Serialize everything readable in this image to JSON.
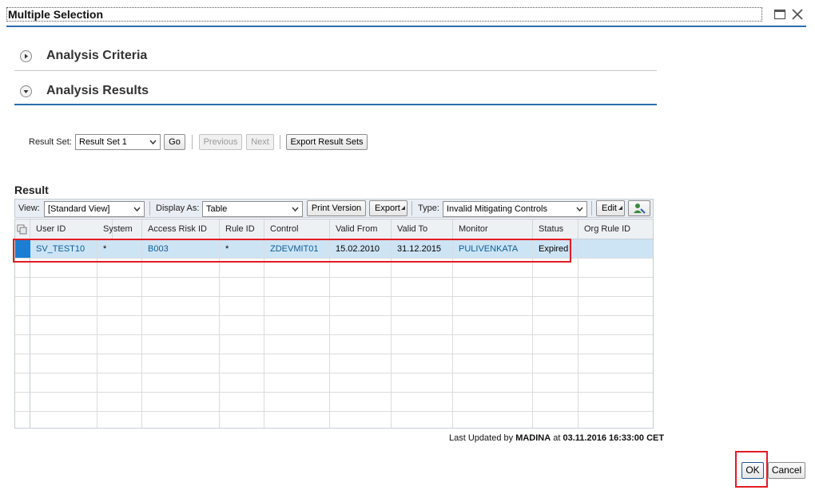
{
  "window": {
    "title": "Multiple Selection"
  },
  "sections": {
    "criteria": {
      "title": "Analysis Criteria"
    },
    "results": {
      "title": "Analysis Results"
    }
  },
  "result_set": {
    "label": "Result Set:",
    "selected": "Result Set 1",
    "go": "Go",
    "previous": "Previous",
    "next": "Next",
    "export_sets": "Export Result Sets"
  },
  "result": {
    "title": "Result",
    "toolbar": {
      "view_label": "View:",
      "view_value": "[Standard View]",
      "display_label": "Display As:",
      "display_value": "Table",
      "print": "Print Version",
      "export": "Export",
      "type_label": "Type:",
      "type_value": "Invalid Mitigating Controls",
      "edit": "Edit"
    },
    "columns": [
      "User ID",
      "System",
      "Access Risk ID",
      "Rule ID",
      "Control",
      "Valid From",
      "Valid To",
      "Monitor",
      "Status",
      "Org Rule ID"
    ],
    "rows": [
      [
        "SV_TEST10",
        "*",
        "B003",
        "*",
        "ZDEVMIT01",
        "15.02.2010",
        "31.12.2015",
        "PULIVENKATA",
        "Expired",
        ""
      ]
    ],
    "empty_row_count": 9
  },
  "footer": {
    "updated_prefix": "Last Updated by",
    "updated_user": "MADINA",
    "updated_at": "at",
    "updated_time": "03.11.2016 16:33:00 CET"
  },
  "buttons": {
    "ok": "OK",
    "cancel": "Cancel"
  },
  "colors": {
    "accent": "#2b6fad",
    "link": "#0b5c99",
    "selection": "#cde4f4",
    "highlight": "#e31b23"
  }
}
